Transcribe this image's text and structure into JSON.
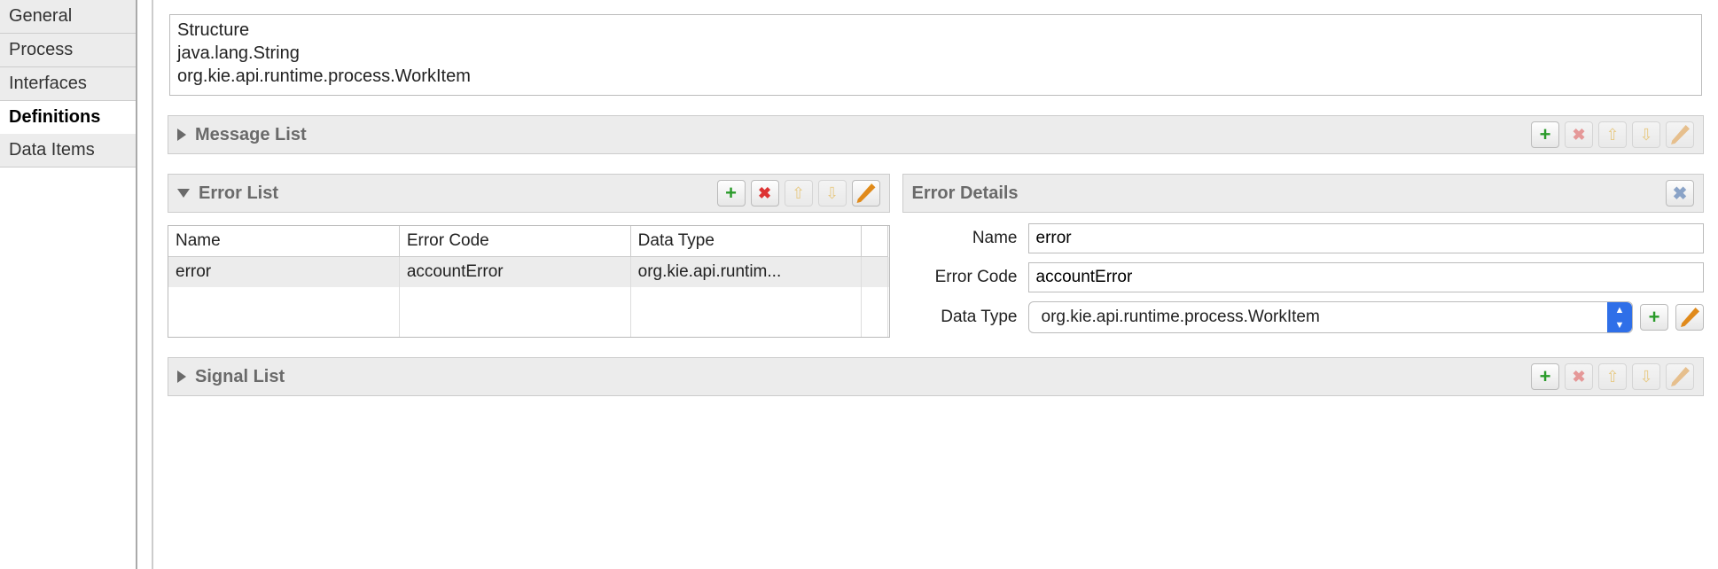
{
  "sidebar": {
    "tabs": [
      {
        "label": "General",
        "active": false
      },
      {
        "label": "Process",
        "active": false
      },
      {
        "label": "Interfaces",
        "active": false
      },
      {
        "label": "Definitions",
        "active": true
      },
      {
        "label": "Data Items",
        "active": false
      }
    ]
  },
  "structure_list": {
    "items": [
      "Structure",
      "java.lang.String",
      "org.kie.api.runtime.process.WorkItem"
    ]
  },
  "message_list": {
    "title": "Message List",
    "expanded": false
  },
  "error_list": {
    "title": "Error List",
    "expanded": true,
    "columns": [
      "Name",
      "Error Code",
      "Data Type"
    ],
    "rows": [
      {
        "name": "error",
        "code": "accountError",
        "type": "org.kie.api.runtim..."
      }
    ]
  },
  "error_details": {
    "title": "Error Details",
    "fields": {
      "name_label": "Name",
      "name_value": "error",
      "code_label": "Error Code",
      "code_value": "accountError",
      "type_label": "Data Type",
      "type_value": "org.kie.api.runtime.process.WorkItem"
    }
  },
  "signal_list": {
    "title": "Signal List",
    "expanded": false
  }
}
